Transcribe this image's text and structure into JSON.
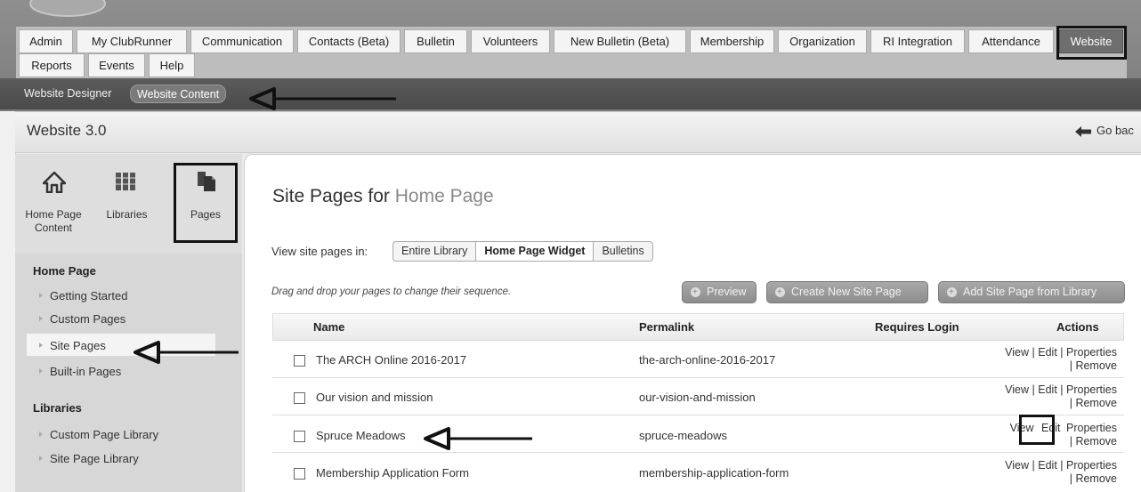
{
  "nav": {
    "tabs_row1": [
      "Admin",
      "My ClubRunner",
      "Communication",
      "Contacts (Beta)",
      "Bulletin",
      "Volunteers",
      "New Bulletin (Beta)",
      "Membership",
      "Organization",
      "RI Integration",
      "Attendance",
      "Website"
    ],
    "tabs_row2": [
      "Reports",
      "Events",
      "Help"
    ],
    "active_tab": "Website"
  },
  "subnav": {
    "items": [
      "Website Designer",
      "Website Content"
    ],
    "active": "Website Content"
  },
  "panel": {
    "title": "Website 3.0",
    "go_back": "Go bac"
  },
  "sidebar": {
    "icons": [
      {
        "icon": "home-icon",
        "label": "Home Page Content"
      },
      {
        "icon": "libraries-icon",
        "label": "Libraries"
      },
      {
        "icon": "pages-icon",
        "label": "Pages"
      }
    ],
    "section1": {
      "title": "Home Page",
      "items": [
        "Getting Started",
        "Custom Pages",
        "Site Pages",
        "Built-in Pages"
      ]
    },
    "section2": {
      "title": "Libraries",
      "items": [
        "Custom Page Library",
        "Site Page Library"
      ]
    },
    "active_item": "Site Pages"
  },
  "main": {
    "heading_prefix": "Site Pages for",
    "heading_target": "Home Page",
    "view_label": "View site pages in:",
    "view_options": [
      "Entire Library",
      "Home Page Widget",
      "Bulletins"
    ],
    "view_active": "Home Page Widget",
    "drag_note": "Drag and drop your pages to change their sequence.",
    "buttons": {
      "preview": "Preview",
      "create": "Create New Site Page",
      "add": "Add Site Page from Library"
    },
    "table": {
      "columns": [
        "Name",
        "Permalink",
        "Requires Login",
        "Actions"
      ],
      "rows": [
        {
          "name": "The ARCH Online 2016-2017",
          "permalink": "the-arch-online-2016-2017"
        },
        {
          "name": "Our vision and mission",
          "permalink": "our-vision-and-mission"
        },
        {
          "name": "Spruce Meadows",
          "permalink": "spruce-meadows"
        },
        {
          "name": "Membership Application Form",
          "permalink": "membership-application-form"
        }
      ],
      "actions": {
        "view": "View",
        "sep": "|",
        "edit": "Edit",
        "properties": "Properties",
        "remove": "Remove"
      }
    }
  },
  "colors": {
    "annotation": "#111111",
    "header": "#7c7c7c",
    "subnav": "#4f4f4f"
  }
}
